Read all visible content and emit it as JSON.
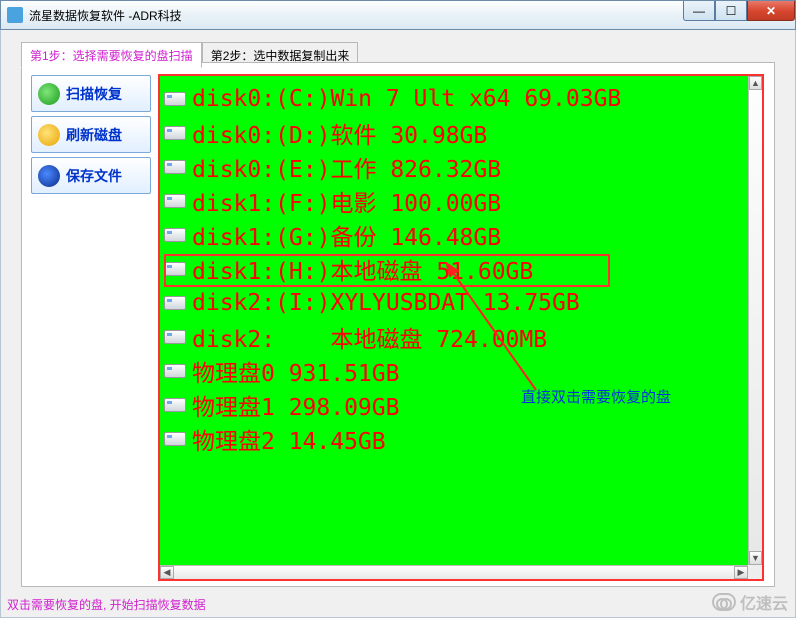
{
  "window": {
    "title": "流星数据恢复软件   -ADR科技"
  },
  "tabs": {
    "tab1": "第1步：选择需要恢复的盘扫描",
    "tab2": "第2步：选中数据复制出来"
  },
  "sidebar": {
    "scan": "扫描恢复",
    "refresh": "刷新磁盘",
    "save": "保存文件"
  },
  "disks": [
    {
      "label": "disk0:(C:)Win 7 Ult x64 69.03GB"
    },
    {
      "label": "disk0:(D:)软件 30.98GB"
    },
    {
      "label": "disk0:(E:)工作 826.32GB"
    },
    {
      "label": "disk1:(F:)电影 100.00GB"
    },
    {
      "label": "disk1:(G:)备份 146.48GB"
    },
    {
      "label": "disk1:(H:)本地磁盘 51.60GB"
    },
    {
      "label": "disk2:(I:)XYLYUSBDAT 13.75GB"
    },
    {
      "label": "disk2:    本地磁盘 724.00MB"
    },
    {
      "label": "物理盘0 931.51GB"
    },
    {
      "label": "物理盘1 298.09GB"
    },
    {
      "label": "物理盘2 14.45GB"
    }
  ],
  "annotation": {
    "text": "直接双击需要恢复的盘"
  },
  "statusbar": {
    "text": "双击需要恢复的盘, 开始扫描恢复数据"
  },
  "watermark": {
    "text": "亿速云"
  }
}
